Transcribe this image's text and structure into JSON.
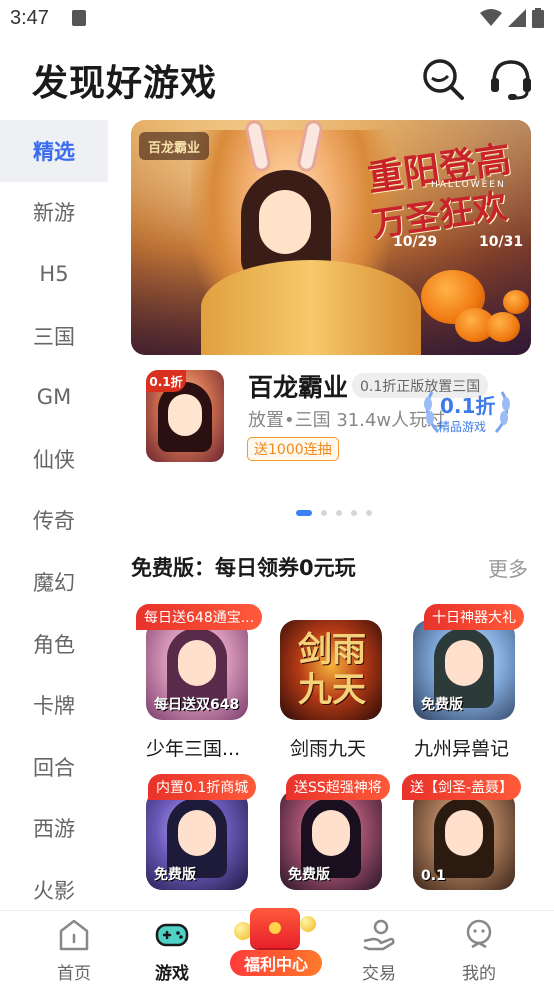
{
  "status_bar": {
    "time": "3:47"
  },
  "header": {
    "title": "发现好游戏"
  },
  "sidebar": {
    "items": [
      {
        "label": "精选",
        "active": true
      },
      {
        "label": "新游"
      },
      {
        "label": "H5"
      },
      {
        "label": "三国"
      },
      {
        "label": "GM"
      },
      {
        "label": "仙侠"
      },
      {
        "label": "传奇"
      },
      {
        "label": "魔幻"
      },
      {
        "label": "角色"
      },
      {
        "label": "卡牌"
      },
      {
        "label": "回合"
      },
      {
        "label": "西游"
      },
      {
        "label": "火影"
      }
    ]
  },
  "banner": {
    "logo": "百龙霸业",
    "headline_1": "重阳登高",
    "halloween": "HALLOWEEN",
    "headline_2": "万圣狂欢",
    "date_start": "10/29",
    "date_end": "10/31"
  },
  "featured": {
    "icon_badge": "0.1折",
    "name": "百龙霸业",
    "tag": "0.1折正版放置三国",
    "meta": "放置•三国  31.4w人玩过",
    "gift": "送1000连抽",
    "discount": "0.1折",
    "discount_label": "精品游戏"
  },
  "carousel": {
    "count": 5,
    "active_index": 0
  },
  "section": {
    "title": "免费版：每日领券0元玩",
    "more": "更多"
  },
  "games": [
    {
      "title": "少年三国...",
      "ribbon": "每日送648通宝...",
      "icon_caption": "每日送双648"
    },
    {
      "title": "剑雨九天",
      "ribbon": "",
      "icon_caption": "剑雨 九天"
    },
    {
      "title": "九州异兽记",
      "ribbon": "十日神器大礼",
      "icon_caption": "免费版"
    },
    {
      "title": "",
      "ribbon": "内置0.1折商城",
      "icon_caption": "免费版"
    },
    {
      "title": "",
      "ribbon": "送SS超强神将",
      "icon_caption": "免费版"
    },
    {
      "title": "",
      "ribbon": "送【剑圣-盖聂】",
      "icon_caption": "0.1"
    }
  ],
  "tabbar": {
    "home": "首页",
    "games": "游戏",
    "welfare": "福利中心",
    "trade": "交易",
    "mine": "我的"
  },
  "colors": {
    "accent": "#3b6cf0",
    "ribbon": "#e8322a",
    "gift": "#f08a1a",
    "sidebar_active_bg": "#eef0f4"
  }
}
